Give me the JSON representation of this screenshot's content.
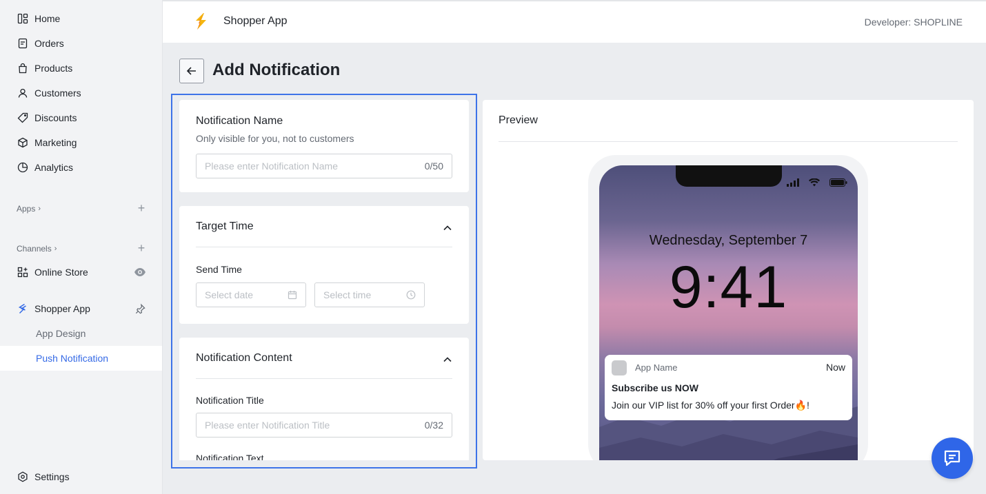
{
  "sidebar": {
    "items": [
      {
        "label": "Home",
        "icon": "home-icon"
      },
      {
        "label": "Orders",
        "icon": "orders-icon"
      },
      {
        "label": "Products",
        "icon": "bag-icon"
      },
      {
        "label": "Customers",
        "icon": "user-icon"
      },
      {
        "label": "Discounts",
        "icon": "tag-icon"
      },
      {
        "label": "Marketing",
        "icon": "cube-icon"
      },
      {
        "label": "Analytics",
        "icon": "pie-chart-icon"
      }
    ],
    "apps_label": "Apps",
    "channels_label": "Channels",
    "online_store": "Online Store",
    "shopper_app": "Shopper App",
    "sub_items": [
      {
        "label": "App Design"
      },
      {
        "label": "Push Notification"
      }
    ],
    "settings": "Settings"
  },
  "header": {
    "app_title": "Shopper App",
    "developer": "Developer: SHOPLINE"
  },
  "page": {
    "title": "Add Notification"
  },
  "form": {
    "name_card": {
      "title": "Notification Name",
      "subtitle": "Only visible for you, not to customers",
      "placeholder": "Please enter Notification Name",
      "count": "0/50"
    },
    "time_card": {
      "title": "Target Time",
      "send_time_label": "Send Time",
      "date_placeholder": "Select date",
      "time_placeholder": "Select time"
    },
    "content_card": {
      "title": "Notification Content",
      "title_label": "Notification Title",
      "title_placeholder": "Please enter Notification Title",
      "title_count": "0/32",
      "text_label": "Notification Text"
    }
  },
  "preview": {
    "title": "Preview",
    "date": "Wednesday, September 7",
    "time": "9:41",
    "notification": {
      "app_name": "App Name",
      "when": "Now",
      "title": "Subscribe us NOW",
      "body": "Join our VIP list for 30% off your first Order🔥!"
    }
  },
  "colors": {
    "accent": "#356ae6",
    "highlight_border": "#3d73e8",
    "chat_button": "#2f66e8"
  }
}
